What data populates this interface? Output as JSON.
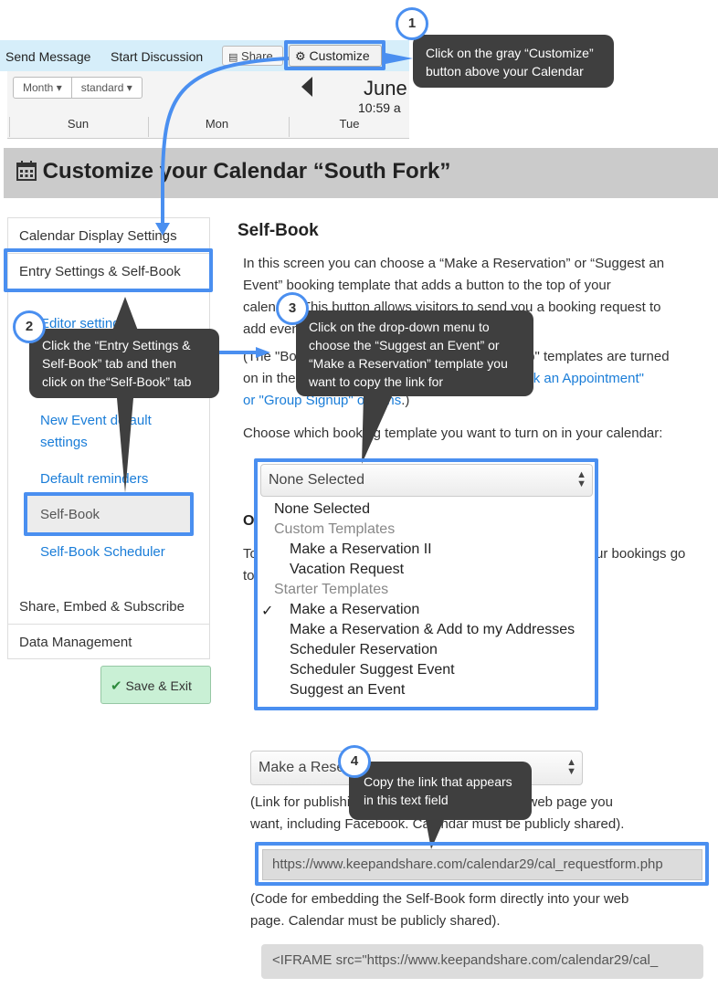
{
  "toolbar": {
    "send_message": "Send Message",
    "start_discussion": "Start Discussion",
    "share": "Share",
    "customize": "Customize"
  },
  "calendar": {
    "view_mode": "Month",
    "view_style": "standard",
    "month": "June",
    "time": "10:59 a",
    "days": [
      "Sun",
      "Mon",
      "Tue"
    ]
  },
  "page_title": "Customize your Calendar “South Fork”",
  "sidebar": {
    "items": [
      "Calendar Display Settings",
      "Entry Settings & Self-Book",
      "Share, Embed & Subscribe",
      "Data Management"
    ],
    "subitems": [
      "Editor settings",
      "New Event default",
      "settings",
      "Default reminders",
      "Self-Book",
      "Self-Book Scheduler"
    ],
    "save_label": "Save & Exit"
  },
  "main": {
    "section_title": "Self-Book",
    "para1": [
      "In this screen you can choose a “Make a Reservation” or “Suggest an",
      "Event” booking template that adds a button to the top of your",
      "calendar. This button allows visitors to send you a booking request to",
      "add events to your calendar."
    ],
    "para2_a": "(The \"Book an Appointment\" and \"Group Signup\" templates are turned",
    "para2_b": "on in the",
    "para2_link1": "\"Book an Appointment\"",
    "para2_link2": "or \"Group Signup\" options",
    "para2_end": ".)",
    "choose_text": "Choose which booking template you want to turn on in your calendar:",
    "dropdown_selected": "None Selected",
    "options": {
      "none": "None Selected",
      "custom_group": "Custom Templates",
      "custom": [
        "Make a Reservation II",
        "Vacation Request"
      ],
      "starter_group": "Starter Templates",
      "starter": [
        "Make a Reservation",
        "Make a Reservation & Add to my Addresses",
        "Scheduler Reservation",
        "Scheduler Suggest Event",
        "Suggest an Event"
      ]
    },
    "behind_heading": "O",
    "behind_line1": "To",
    "behind_line1_end": "ur bookings go",
    "behind_line2": "to",
    "second_select": "Make a Rese",
    "link_note": [
      "(Link for publishing your booking form on any web page you",
      "want, including Facebook. Calendar must be publicly shared)."
    ],
    "url_value": "https://www.keepandshare.com/calendar29/cal_requestform.php",
    "embed_note": [
      "(Code for embedding the Self-Book form directly into your web",
      "page. Calendar must be publicly shared)."
    ],
    "iframe_value": "<IFRAME src=\"https://www.keepandshare.com/calendar29/cal_"
  },
  "callouts": {
    "step1": {
      "num": "1",
      "text": [
        "Click on the gray “Customize”",
        "button above your Calendar"
      ]
    },
    "step2": {
      "num": "2",
      "text": [
        "Click the “Entry Settings &",
        "Self-Book” tab and then",
        "click on the“Self-Book” tab"
      ]
    },
    "step3": {
      "num": "3",
      "text": [
        "Click on the drop-down menu to",
        "choose the “Suggest an Event” or",
        "“Make a Reservation” template you",
        "want to copy the link for"
      ]
    },
    "step4": {
      "num": "4",
      "text": [
        "Copy the link that appears",
        "in this text field"
      ]
    }
  },
  "colors": {
    "highlight": "#4a8ff0",
    "callout_bg": "#3f3f3f",
    "link": "#1a7dd8",
    "save_bg": "#c9f0d5",
    "save_check": "#2e8b3d",
    "header_bg": "#cbcbcb",
    "toolbar_bg": "#d6eefa"
  },
  "icons": {
    "customize": "gear-icon",
    "share": "share-icon",
    "title": "calendar-icon",
    "save": "checkmark-icon",
    "prev": "chevron-left-icon",
    "select": "select-arrows-icon",
    "selected": "checkmark-icon"
  }
}
